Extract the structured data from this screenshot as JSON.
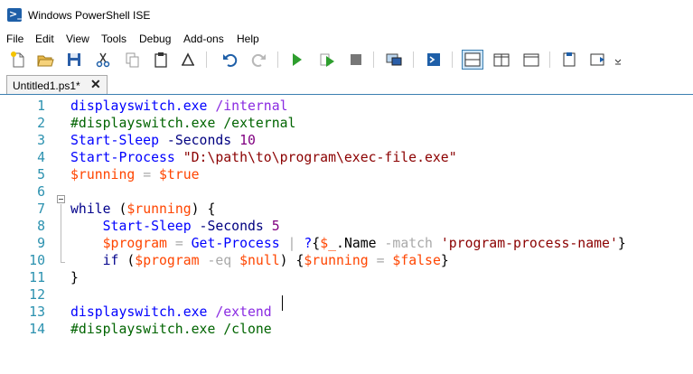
{
  "window": {
    "title": "Windows PowerShell ISE"
  },
  "menu": [
    "File",
    "Edit",
    "View",
    "Tools",
    "Debug",
    "Add-ons",
    "Help"
  ],
  "toolbar": {
    "buttons": [
      "new-file-icon",
      "open-folder-icon",
      "save-icon",
      "cut-icon",
      "copy-icon",
      "paste-icon",
      "clear-console-icon",
      "undo-icon",
      "redo-icon",
      "run-script-icon",
      "run-selection-icon",
      "stop-icon",
      "new-remote-tab-icon",
      "start-powershell-icon",
      "show-script-pane-top-icon",
      "show-script-pane-right-icon",
      "show-script-pane-maximized-icon",
      "show-command-window-icon",
      "show-command-addon-icon",
      "toolbar-overflow-icon"
    ]
  },
  "tab": {
    "label": "Untitled1.ps1*",
    "close": "✕"
  },
  "editor": {
    "lines": [
      {
        "n": "1",
        "tokens": [
          {
            "t": "displayswitch.exe",
            "c": "cmd"
          },
          {
            "t": " /internal",
            "c": "arg"
          }
        ]
      },
      {
        "n": "2",
        "tokens": [
          {
            "t": "#displayswitch.exe /external",
            "c": "cmt"
          }
        ]
      },
      {
        "n": "3",
        "tokens": [
          {
            "t": "Start-Sleep",
            "c": "cmd"
          },
          {
            "t": " -Seconds",
            "c": "param"
          },
          {
            "t": " 10",
            "c": "num"
          }
        ]
      },
      {
        "n": "4",
        "tokens": [
          {
            "t": "Start-Process",
            "c": "cmd"
          },
          {
            "t": " \"D:\\path\\to\\program\\exec-file.exe\"",
            "c": "str"
          }
        ]
      },
      {
        "n": "5",
        "tokens": [
          {
            "t": "$running",
            "c": "var"
          },
          {
            "t": " = ",
            "c": "op"
          },
          {
            "t": "$true",
            "c": "var"
          }
        ]
      },
      {
        "n": "6",
        "tokens": []
      },
      {
        "n": "7",
        "tokens": [
          {
            "t": "while",
            "c": "kw"
          },
          {
            "t": " (",
            "c": "grp"
          },
          {
            "t": "$running",
            "c": "var"
          },
          {
            "t": ") {",
            "c": "grp"
          }
        ]
      },
      {
        "n": "8",
        "tokens": [
          {
            "t": "    Start-Sleep",
            "c": "cmd"
          },
          {
            "t": " -Seconds",
            "c": "param"
          },
          {
            "t": " 5",
            "c": "num"
          }
        ]
      },
      {
        "n": "9",
        "tokens": [
          {
            "t": "    $program",
            "c": "var"
          },
          {
            "t": " = ",
            "c": "op"
          },
          {
            "t": "Get-Process",
            "c": "cmd"
          },
          {
            "t": " | ",
            "c": "op"
          },
          {
            "t": "?",
            "c": "cmd"
          },
          {
            "t": "{",
            "c": "grp"
          },
          {
            "t": "$_",
            "c": "var"
          },
          {
            "t": ".Name",
            "c": "grp"
          },
          {
            "t": " -match",
            "c": "op"
          },
          {
            "t": " 'program-process-name'",
            "c": "str"
          },
          {
            "t": "}",
            "c": "grp"
          }
        ]
      },
      {
        "n": "10",
        "tokens": [
          {
            "t": "    if",
            "c": "kw"
          },
          {
            "t": " (",
            "c": "grp"
          },
          {
            "t": "$program",
            "c": "var"
          },
          {
            "t": " -eq",
            "c": "op"
          },
          {
            "t": " $null",
            "c": "var"
          },
          {
            "t": ") {",
            "c": "grp"
          },
          {
            "t": "$running",
            "c": "var"
          },
          {
            "t": " = ",
            "c": "op"
          },
          {
            "t": "$false",
            "c": "var"
          },
          {
            "t": "}",
            "c": "grp"
          }
        ]
      },
      {
        "n": "11",
        "tokens": [
          {
            "t": "}",
            "c": "grp"
          }
        ]
      },
      {
        "n": "12",
        "tokens": []
      },
      {
        "n": "13",
        "tokens": [
          {
            "t": "displayswitch.exe",
            "c": "cmd"
          },
          {
            "t": " /extend",
            "c": "arg"
          }
        ]
      },
      {
        "n": "14",
        "tokens": [
          {
            "t": "#displayswitch.exe /clone",
            "c": "cmt"
          }
        ]
      }
    ]
  },
  "colors": {
    "tab_border": "#a9a9a9",
    "line_number": "#2b91af",
    "accent": "#3c7fb1"
  }
}
